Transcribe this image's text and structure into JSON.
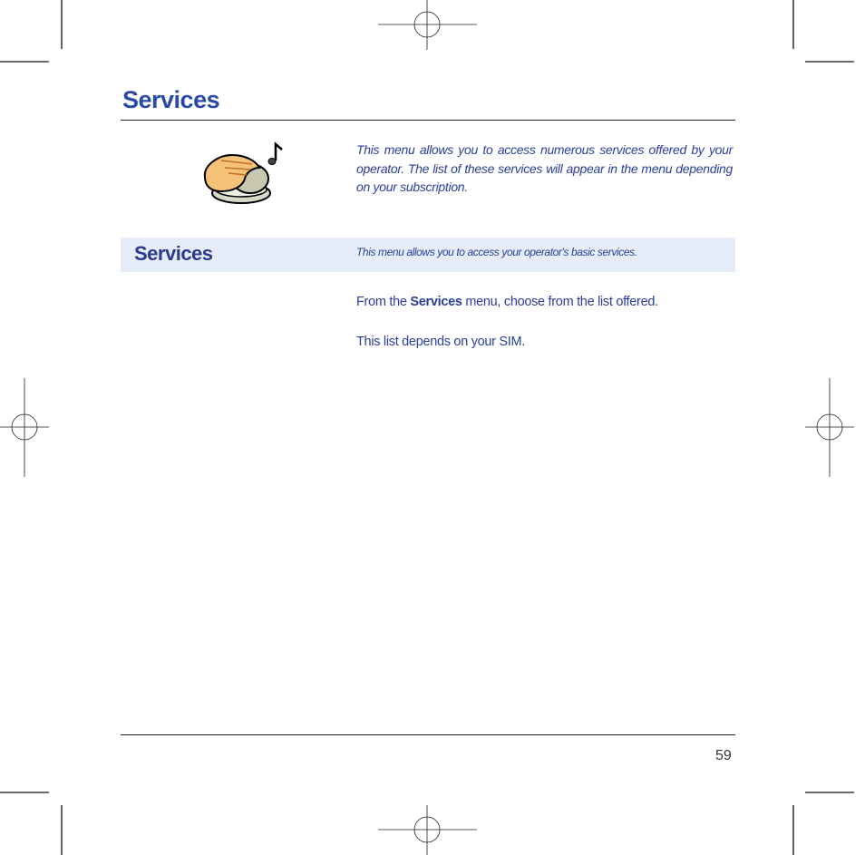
{
  "page": {
    "title": "Services",
    "icon": "hand-on-mouse-with-music-note-icon",
    "intro": "This menu allows you to access numerous services offered by your operator. The list of these services will appear in the menu depending on your subscription.",
    "section": {
      "title": "Services",
      "description": "This menu allows you to access your operator's basic services."
    },
    "paragraphs": [
      {
        "before": "From the ",
        "bold": "Services",
        "after": " menu, choose from the list offered."
      },
      {
        "text": "This list depends on your SIM."
      }
    ],
    "page_number": "59"
  }
}
